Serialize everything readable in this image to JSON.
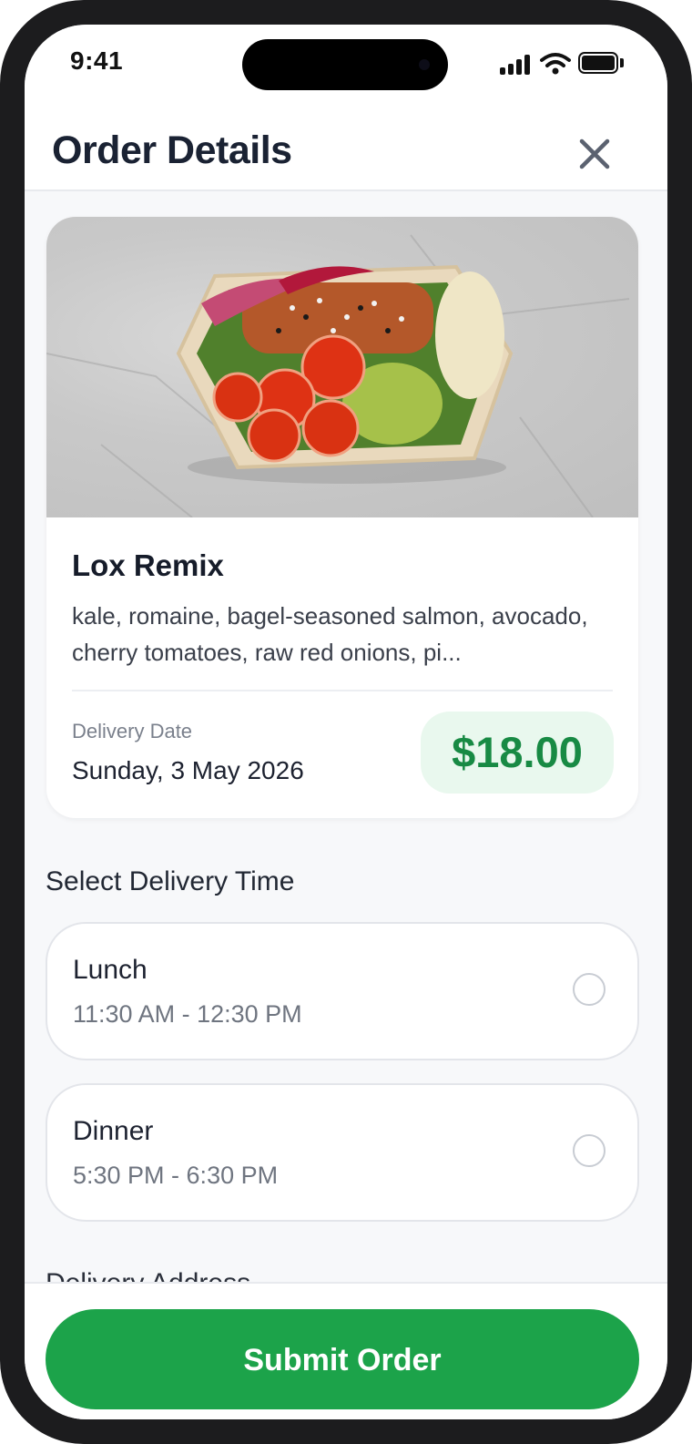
{
  "status_bar": {
    "time": "9:41"
  },
  "header": {
    "title": "Order Details"
  },
  "dish": {
    "name": "Lox Remix",
    "description": "kale, romaine, bagel-seasoned salmon, avocado, cherry tomatoes, raw red onions, pi...",
    "delivery_date_label": "Delivery Date",
    "delivery_date": "Sunday, 3 May 2026",
    "price": "$18.00"
  },
  "delivery_time": {
    "section_title": "Select Delivery Time",
    "options": [
      {
        "name": "Lunch",
        "time": "11:30 AM - 12:30 PM",
        "selected": false
      },
      {
        "name": "Dinner",
        "time": "5:30 PM - 6:30 PM",
        "selected": false
      }
    ]
  },
  "address_section_title": "Delivery Address",
  "footer": {
    "submit_label": "Submit Order"
  },
  "colors": {
    "accent": "#1ca34a",
    "price_text": "#188a44",
    "price_bg": "#e9f8ee"
  }
}
